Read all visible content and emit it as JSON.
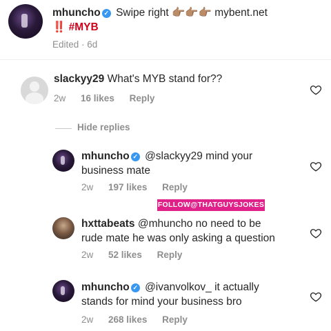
{
  "post": {
    "username": "mhuncho",
    "caption_line1": "Swipe right 👉🏽👉🏽👉🏽 mybent.net",
    "caption_line2": "‼️ #MYB",
    "edited": "Edited · 6d"
  },
  "hide_replies": "Hide replies",
  "watermark": "FOLLOW@THATGUYSJOKES",
  "comments": [
    {
      "username": "slackyy29",
      "text_line1": "What's MYB stand for??",
      "text_line2": "",
      "time": "2w",
      "likes": "16 likes",
      "reply": "Reply"
    },
    {
      "username": "mhuncho",
      "text_line1": "@slackyy29 mind your",
      "text_line2": "business mate",
      "time": "2w",
      "likes": "197 likes",
      "reply": "Reply"
    },
    {
      "username": "hxttabeats",
      "text_line1": "@mhuncho no need to be",
      "text_line2": "rude mate he was only asking a question",
      "time": "2w",
      "likes": "52 likes",
      "reply": "Reply"
    },
    {
      "username": "mhuncho",
      "text_line1": "@ivanvolkov_ it actually",
      "text_line2": "stands for mind your business bro",
      "time": "2w",
      "likes": "268 likes",
      "reply": "Reply"
    }
  ],
  "icons": {
    "verified": "verified-badge-icon",
    "like": "heart-icon",
    "avatar_default": "default-avatar-icon"
  },
  "colors": {
    "verified_blue": "#3897f0",
    "meta_gray": "#8e8e8e",
    "watermark_pink": "#e0218a"
  }
}
